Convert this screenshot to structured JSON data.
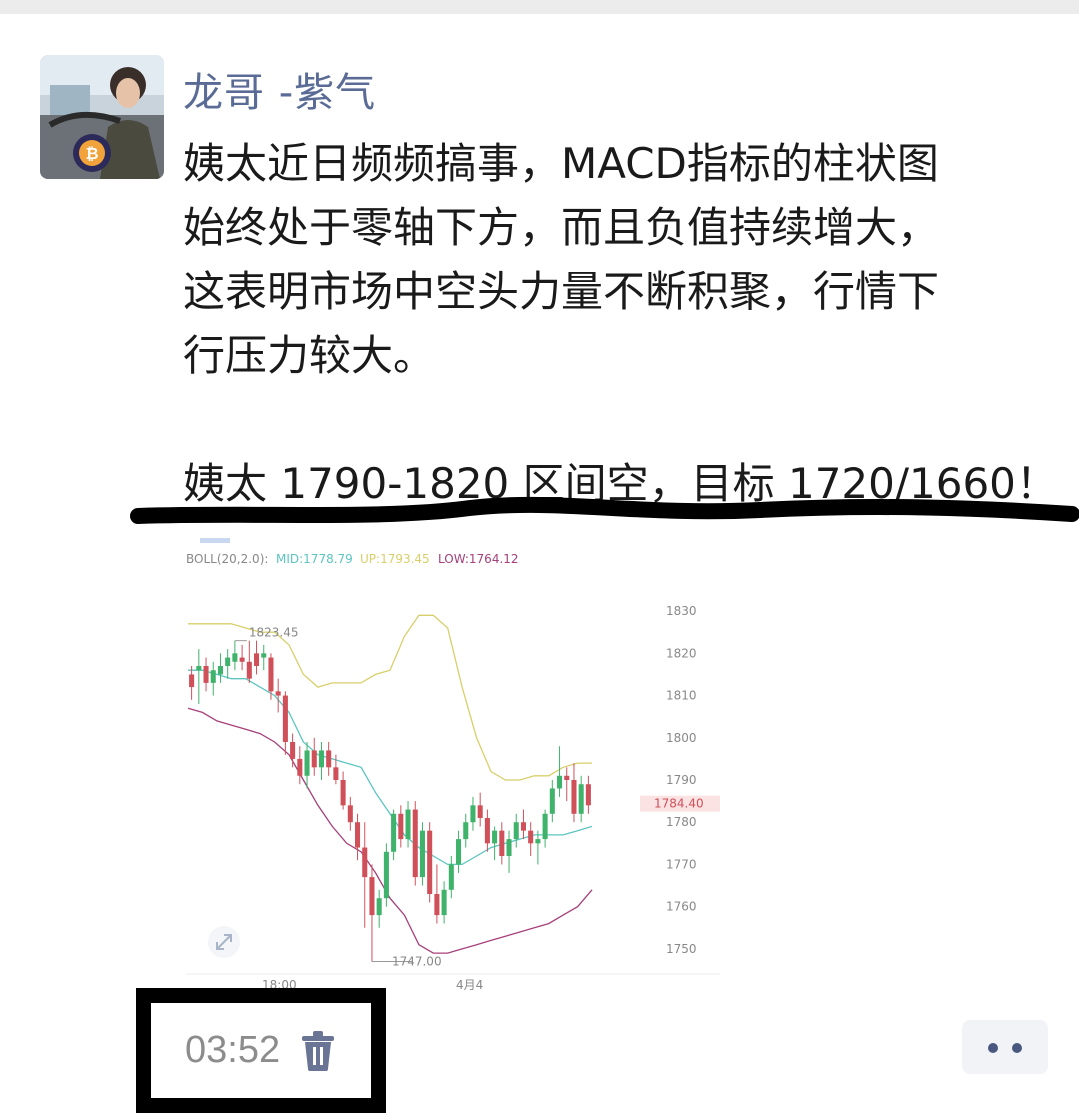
{
  "post": {
    "author": "龙哥 -紫气",
    "lines": [
      "姨太近日频频搞事，MACD指标的柱状图",
      "始终处于零轴下方，而且负值持续增大，",
      "这表明市场中空头力量不断积聚，行情下",
      "行压力较大。",
      "姨太 1790-1820 区间空，目标 1720/1660！"
    ],
    "time": "03:52"
  },
  "icons": {
    "avatar": "avatar",
    "bitcoin": "bitcoin-icon",
    "expand": "expand-icon",
    "trash": "trash-icon",
    "more": "more-icon"
  },
  "colors": {
    "author": "#5a6b95",
    "bull": "#3fb36b",
    "bear": "#d0505a",
    "boll_mid": "#5cc5c0",
    "boll_up": "#d8cf6a",
    "boll_low": "#a5407a"
  },
  "chart_data": {
    "type": "candlestick",
    "indicator": "BOLL(20,2.0)",
    "legend": {
      "name": "BOLL(20,2.0):",
      "mid": "MID:1778.79",
      "up": "UP:1793.45",
      "low": "LOW:1764.12"
    },
    "y_ticks": [
      "1830",
      "1820",
      "1810",
      "1800",
      "1790",
      "1780",
      "1770",
      "1760",
      "1750"
    ],
    "ylim": [
      1745,
      1835
    ],
    "x_ticks": [
      "18:00",
      "4月4"
    ],
    "current_price": "1784.40",
    "high_label": "1823.45",
    "low_label": "1747.00",
    "candles": [
      [
        1815,
        1817,
        1809,
        1812
      ],
      [
        1816,
        1821,
        1808,
        1817
      ],
      [
        1817,
        1819,
        1811,
        1813
      ],
      [
        1813,
        1818,
        1810,
        1816
      ],
      [
        1815,
        1820,
        1813,
        1817
      ],
      [
        1817,
        1821,
        1814,
        1819
      ],
      [
        1818,
        1823,
        1816,
        1820
      ],
      [
        1819,
        1822,
        1816,
        1818
      ],
      [
        1818,
        1823,
        1813,
        1814
      ],
      [
        1820,
        1823,
        1815,
        1817
      ],
      [
        1819,
        1822,
        1816,
        1820
      ],
      [
        1819,
        1820,
        1809,
        1811
      ],
      [
        1811,
        1814,
        1806,
        1810
      ],
      [
        1810,
        1811,
        1796,
        1799
      ],
      [
        1799,
        1801,
        1793,
        1795
      ],
      [
        1795,
        1798,
        1789,
        1791
      ],
      [
        1791,
        1799,
        1788,
        1797
      ],
      [
        1797,
        1800,
        1791,
        1793
      ],
      [
        1793,
        1799,
        1790,
        1797
      ],
      [
        1797,
        1799,
        1791,
        1793
      ],
      [
        1793,
        1796,
        1789,
        1790
      ],
      [
        1790,
        1792,
        1783,
        1784
      ],
      [
        1784,
        1786,
        1778,
        1780
      ],
      [
        1780,
        1782,
        1771,
        1774
      ],
      [
        1774,
        1780,
        1755,
        1767
      ],
      [
        1767,
        1770,
        1747,
        1758
      ],
      [
        1758,
        1764,
        1755,
        1762
      ],
      [
        1762,
        1775,
        1760,
        1773
      ],
      [
        1773,
        1783,
        1771,
        1782
      ],
      [
        1782,
        1784,
        1774,
        1776
      ],
      [
        1776,
        1785,
        1774,
        1783
      ],
      [
        1783,
        1785,
        1765,
        1767
      ],
      [
        1767,
        1780,
        1765,
        1778
      ],
      [
        1778,
        1780,
        1761,
        1763
      ],
      [
        1763,
        1770,
        1756,
        1758
      ],
      [
        1758,
        1766,
        1756,
        1764
      ],
      [
        1764,
        1772,
        1762,
        1770
      ],
      [
        1770,
        1778,
        1768,
        1776
      ],
      [
        1776,
        1782,
        1774,
        1780
      ],
      [
        1780,
        1786,
        1778,
        1784
      ],
      [
        1784,
        1787,
        1779,
        1781
      ],
      [
        1781,
        1783,
        1773,
        1775
      ],
      [
        1775,
        1779,
        1771,
        1778
      ],
      [
        1778,
        1780,
        1770,
        1772
      ],
      [
        1772,
        1778,
        1768,
        1776
      ],
      [
        1776,
        1782,
        1774,
        1780
      ],
      [
        1780,
        1783,
        1776,
        1778
      ],
      [
        1778,
        1780,
        1772,
        1775
      ],
      [
        1775,
        1778,
        1770,
        1776
      ],
      [
        1776,
        1783,
        1774,
        1782
      ],
      [
        1782,
        1790,
        1780,
        1788
      ],
      [
        1788,
        1798,
        1786,
        1791
      ],
      [
        1791,
        1793,
        1785,
        1790
      ],
      [
        1790,
        1794,
        1780,
        1782
      ],
      [
        1782,
        1791,
        1780,
        1789
      ],
      [
        1789,
        1791,
        1782,
        1784
      ]
    ],
    "boll_up": [
      1827,
      1827,
      1827,
      1827,
      1826,
      1825,
      1825,
      1822,
      1815,
      1812,
      1813,
      1813,
      1813,
      1815,
      1816,
      1824,
      1829,
      1829,
      1826,
      1812,
      1800,
      1792,
      1790,
      1790,
      1791,
      1791,
      1793,
      1794,
      1794
    ],
    "boll_mid": [
      1816,
      1816,
      1815,
      1814,
      1814,
      1812,
      1810,
      1806,
      1799,
      1796,
      1795,
      1794,
      1793,
      1787,
      1782,
      1777,
      1774,
      1772,
      1770,
      1770,
      1772,
      1774,
      1775,
      1776,
      1777,
      1777,
      1777,
      1778,
      1779
    ],
    "boll_low": [
      1807,
      1806,
      1804,
      1803,
      1802,
      1801,
      1799,
      1796,
      1790,
      1784,
      1779,
      1775,
      1773,
      1768,
      1762,
      1758,
      1751,
      1749,
      1749,
      1750,
      1751,
      1752,
      1753,
      1754,
      1755,
      1756,
      1758,
      1760,
      1764
    ]
  }
}
